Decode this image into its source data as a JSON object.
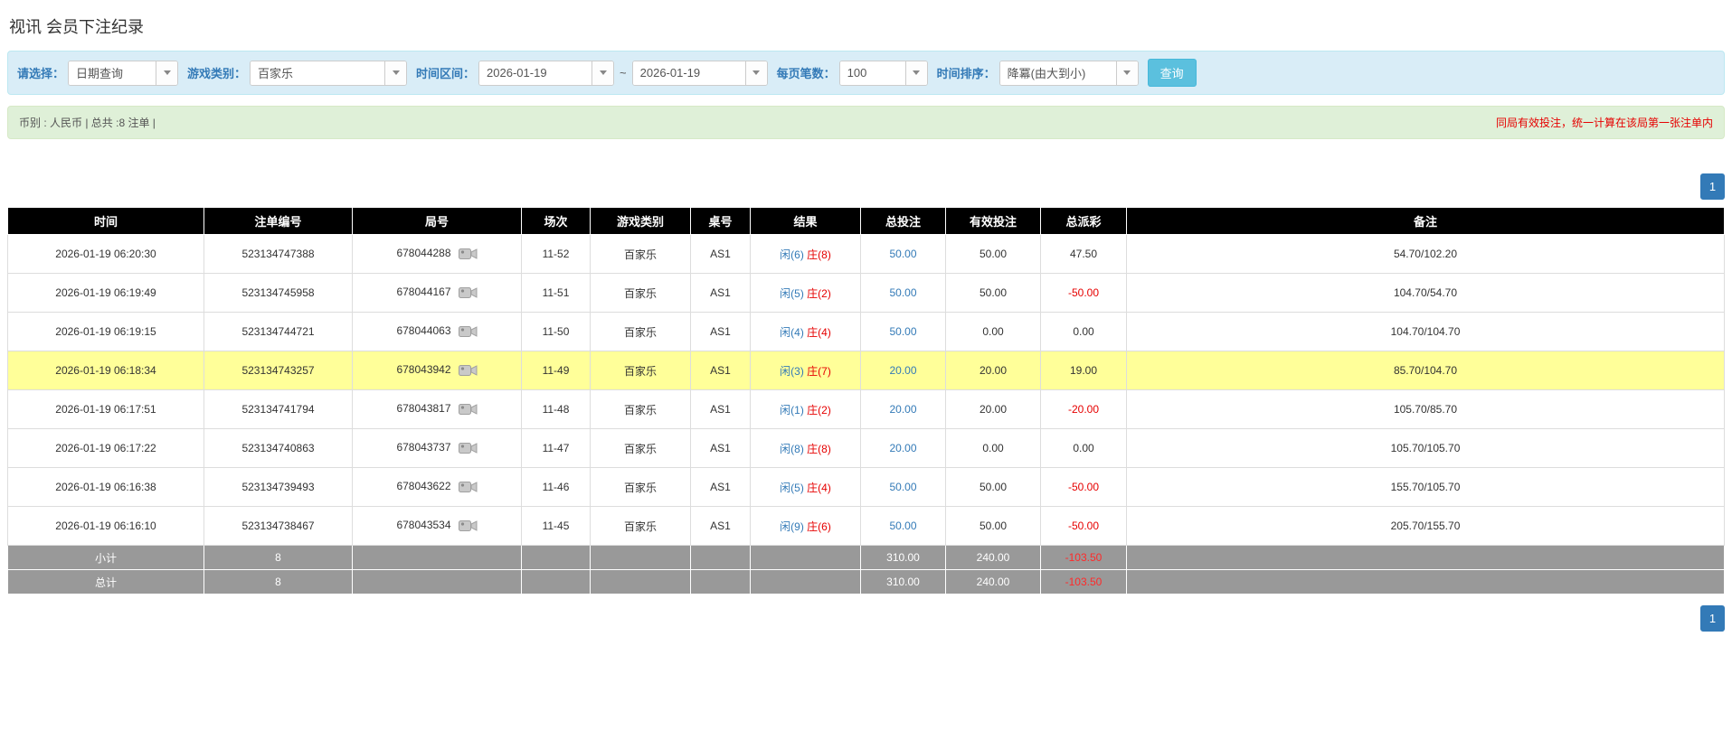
{
  "page": {
    "title": "视讯 会员下注纪录"
  },
  "filters": {
    "select_label": "请选择：",
    "select_value": "日期查询",
    "game_type_label": "游戏类别：",
    "game_type_value": "百家乐",
    "time_range_label": "时间区间：",
    "date_from": "2026-01-19",
    "tilde": "~",
    "date_to": "2026-01-19",
    "page_size_label": "每页笔数：",
    "page_size_value": "100",
    "sort_label": "时间排序：",
    "sort_value": "降冪(由大到小)",
    "search_button": "查询"
  },
  "summary_bar": {
    "left": "币别 : 人民币 | 总共 :8 注单 |",
    "right": "同局有效投注，统一计算在该局第一张注单内"
  },
  "pagination": {
    "page": "1"
  },
  "table": {
    "headers": [
      "时间",
      "注单编号",
      "局号",
      "场次",
      "游戏类别",
      "桌号",
      "结果",
      "总投注",
      "有效投注",
      "总派彩",
      "备注"
    ],
    "rows": [
      {
        "time": "2026-01-19 06:20:30",
        "bet_id": "523134747388",
        "round_id": "678044288",
        "session": "11-52",
        "game_type": "百家乐",
        "table_no": "AS1",
        "result_player": "闲(6)",
        "result_banker": "庄(8)",
        "total_bet": "50.00",
        "valid_bet": "50.00",
        "payout": "47.50",
        "payout_negative": false,
        "remark": "54.70/102.20",
        "highlighted": false
      },
      {
        "time": "2026-01-19 06:19:49",
        "bet_id": "523134745958",
        "round_id": "678044167",
        "session": "11-51",
        "game_type": "百家乐",
        "table_no": "AS1",
        "result_player": "闲(5)",
        "result_banker": "庄(2)",
        "total_bet": "50.00",
        "valid_bet": "50.00",
        "payout": "-50.00",
        "payout_negative": true,
        "remark": "104.70/54.70",
        "highlighted": false
      },
      {
        "time": "2026-01-19 06:19:15",
        "bet_id": "523134744721",
        "round_id": "678044063",
        "session": "11-50",
        "game_type": "百家乐",
        "table_no": "AS1",
        "result_player": "闲(4)",
        "result_banker": "庄(4)",
        "total_bet": "50.00",
        "valid_bet": "0.00",
        "payout": "0.00",
        "payout_negative": false,
        "remark": "104.70/104.70",
        "highlighted": false
      },
      {
        "time": "2026-01-19 06:18:34",
        "bet_id": "523134743257",
        "round_id": "678043942",
        "session": "11-49",
        "game_type": "百家乐",
        "table_no": "AS1",
        "result_player": "闲(3)",
        "result_banker": "庄(7)",
        "total_bet": "20.00",
        "valid_bet": "20.00",
        "payout": "19.00",
        "payout_negative": false,
        "remark": "85.70/104.70",
        "highlighted": true
      },
      {
        "time": "2026-01-19 06:17:51",
        "bet_id": "523134741794",
        "round_id": "678043817",
        "session": "11-48",
        "game_type": "百家乐",
        "table_no": "AS1",
        "result_player": "闲(1)",
        "result_banker": "庄(2)",
        "total_bet": "20.00",
        "valid_bet": "20.00",
        "payout": "-20.00",
        "payout_negative": true,
        "remark": "105.70/85.70",
        "highlighted": false
      },
      {
        "time": "2026-01-19 06:17:22",
        "bet_id": "523134740863",
        "round_id": "678043737",
        "session": "11-47",
        "game_type": "百家乐",
        "table_no": "AS1",
        "result_player": "闲(8)",
        "result_banker": "庄(8)",
        "total_bet": "20.00",
        "valid_bet": "0.00",
        "payout": "0.00",
        "payout_negative": false,
        "remark": "105.70/105.70",
        "highlighted": false
      },
      {
        "time": "2026-01-19 06:16:38",
        "bet_id": "523134739493",
        "round_id": "678043622",
        "session": "11-46",
        "game_type": "百家乐",
        "table_no": "AS1",
        "result_player": "闲(5)",
        "result_banker": "庄(4)",
        "total_bet": "50.00",
        "valid_bet": "50.00",
        "payout": "-50.00",
        "payout_negative": true,
        "remark": "155.70/105.70",
        "highlighted": false
      },
      {
        "time": "2026-01-19 06:16:10",
        "bet_id": "523134738467",
        "round_id": "678043534",
        "session": "11-45",
        "game_type": "百家乐",
        "table_no": "AS1",
        "result_player": "闲(9)",
        "result_banker": "庄(6)",
        "total_bet": "50.00",
        "valid_bet": "50.00",
        "payout": "-50.00",
        "payout_negative": true,
        "remark": "205.70/155.70",
        "highlighted": false
      }
    ],
    "subtotal": {
      "label": "小计",
      "count": "8",
      "total_bet": "310.00",
      "valid_bet": "240.00",
      "payout": "-103.50"
    },
    "total": {
      "label": "总计",
      "count": "8",
      "total_bet": "310.00",
      "valid_bet": "240.00",
      "payout": "-103.50"
    }
  }
}
